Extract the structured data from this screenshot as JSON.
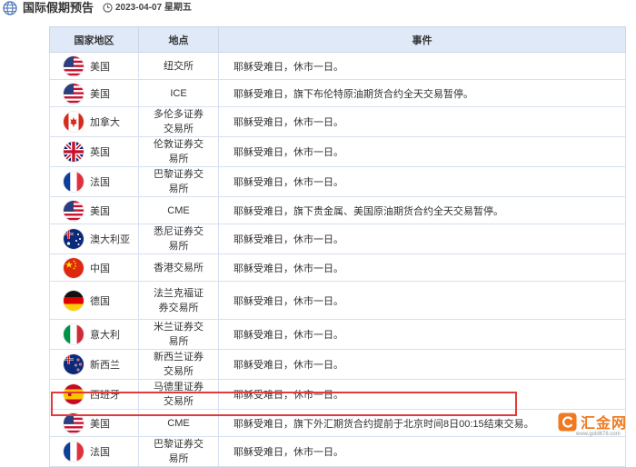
{
  "header": {
    "title": "国际假期预告",
    "date": "2023-04-07 星期五"
  },
  "table": {
    "columns": [
      "国家地区",
      "地点",
      "事件"
    ],
    "rows": [
      {
        "flag": "us-flag-icon",
        "country": "美国",
        "location": "纽交所",
        "event": "耶稣受难日，休市一日。"
      },
      {
        "flag": "us-flag-icon",
        "country": "美国",
        "location": "ICE",
        "event": "耶稣受难日，旗下布伦特原油期货合约全天交易暂停。"
      },
      {
        "flag": "ca-flag-icon",
        "country": "加拿大",
        "location": "多伦多证券交易所",
        "event": "耶稣受难日，休市一日。"
      },
      {
        "flag": "gb-flag-icon",
        "country": "英国",
        "location": "伦敦证券交易所",
        "event": "耶稣受难日，休市一日。"
      },
      {
        "flag": "fr-flag-icon",
        "country": "法国",
        "location": "巴黎证券交易所",
        "event": "耶稣受难日，休市一日。"
      },
      {
        "flag": "us-flag-icon",
        "country": "美国",
        "location": "CME",
        "event": "耶稣受难日，旗下贵金属、美国原油期货合约全天交易暂停。"
      },
      {
        "flag": "au-flag-icon",
        "country": "澳大利亚",
        "location": "悉尼证券交易所",
        "event": "耶稣受难日，休市一日。"
      },
      {
        "flag": "cn-flag-icon",
        "country": "中国",
        "location": "香港交易所",
        "event": "耶稣受难日，休市一日。"
      },
      {
        "flag": "de-flag-icon",
        "country": "德国",
        "location": "法兰克福证券交易所",
        "event": "耶稣受难日，休市一日。"
      },
      {
        "flag": "it-flag-icon",
        "country": "意大利",
        "location": "米兰证券交易所",
        "event": "耶稣受难日，休市一日。"
      },
      {
        "flag": "nz-flag-icon",
        "country": "新西兰",
        "location": "新西兰证券交易所",
        "event": "耶稣受难日，休市一日。"
      },
      {
        "flag": "es-flag-icon",
        "country": "西班牙",
        "location": "马德里证券交易所",
        "event": "耶稣受难日，休市一日。"
      },
      {
        "flag": "us-flag-icon",
        "country": "美国",
        "location": "CME",
        "event": "耶稣受难日，旗下外汇期货合约提前于北京时间8日00:15结束交易。",
        "highlighted": true
      },
      {
        "flag": "fr-flag-icon",
        "country": "法国",
        "location": "巴黎证券交易所",
        "event": "耶稣受难日，休市一日。"
      }
    ]
  },
  "watermark": {
    "name": "汇金网",
    "url": "www.gold678.com"
  },
  "colors": {
    "header_bg": "#dfe9f7",
    "highlight": "#e03a3a",
    "brand": "#f07a22"
  }
}
